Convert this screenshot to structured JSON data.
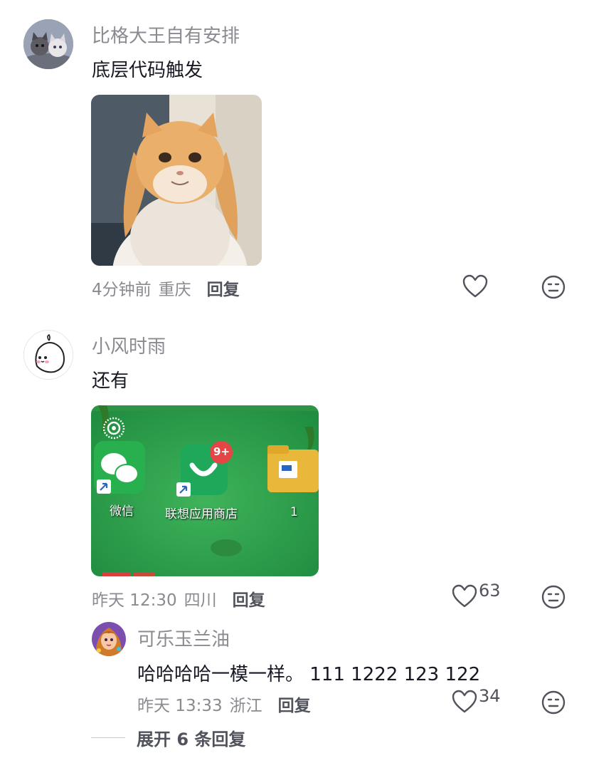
{
  "comments": [
    {
      "username": "比格大王自有安排",
      "text": "底层代码触发",
      "time": "4分钟前",
      "location": "重庆",
      "reply_label": "回复",
      "like_count": "",
      "image_icon": "cat-photo",
      "avatar_icon": "kittens-avatar"
    },
    {
      "username": "小风时雨",
      "text": "还有",
      "time": "昨天 12:30",
      "location": "四川",
      "reply_label": "回复",
      "like_count": "63",
      "image_icon": "phone-screen-photo",
      "avatar_icon": "cartoon-face-avatar",
      "photo_labels": {
        "app1": "微信",
        "app2": "联想应用商店",
        "app3": "1",
        "badge": "9+"
      }
    }
  ],
  "reply": {
    "username": "可乐玉兰油",
    "text": "哈哈哈哈一模一样。 111 1222 123 122",
    "time": "昨天 13:33",
    "location": "浙江",
    "reply_label": "回复",
    "like_count": "34",
    "avatar_icon": "anime-girl-avatar"
  },
  "expand_replies": "展开 6 条回复",
  "colors": {
    "primary_text": "#161823",
    "secondary_text": "#8a8b91",
    "reply_text": "#51535c",
    "wechat_green": "#2aae67"
  }
}
